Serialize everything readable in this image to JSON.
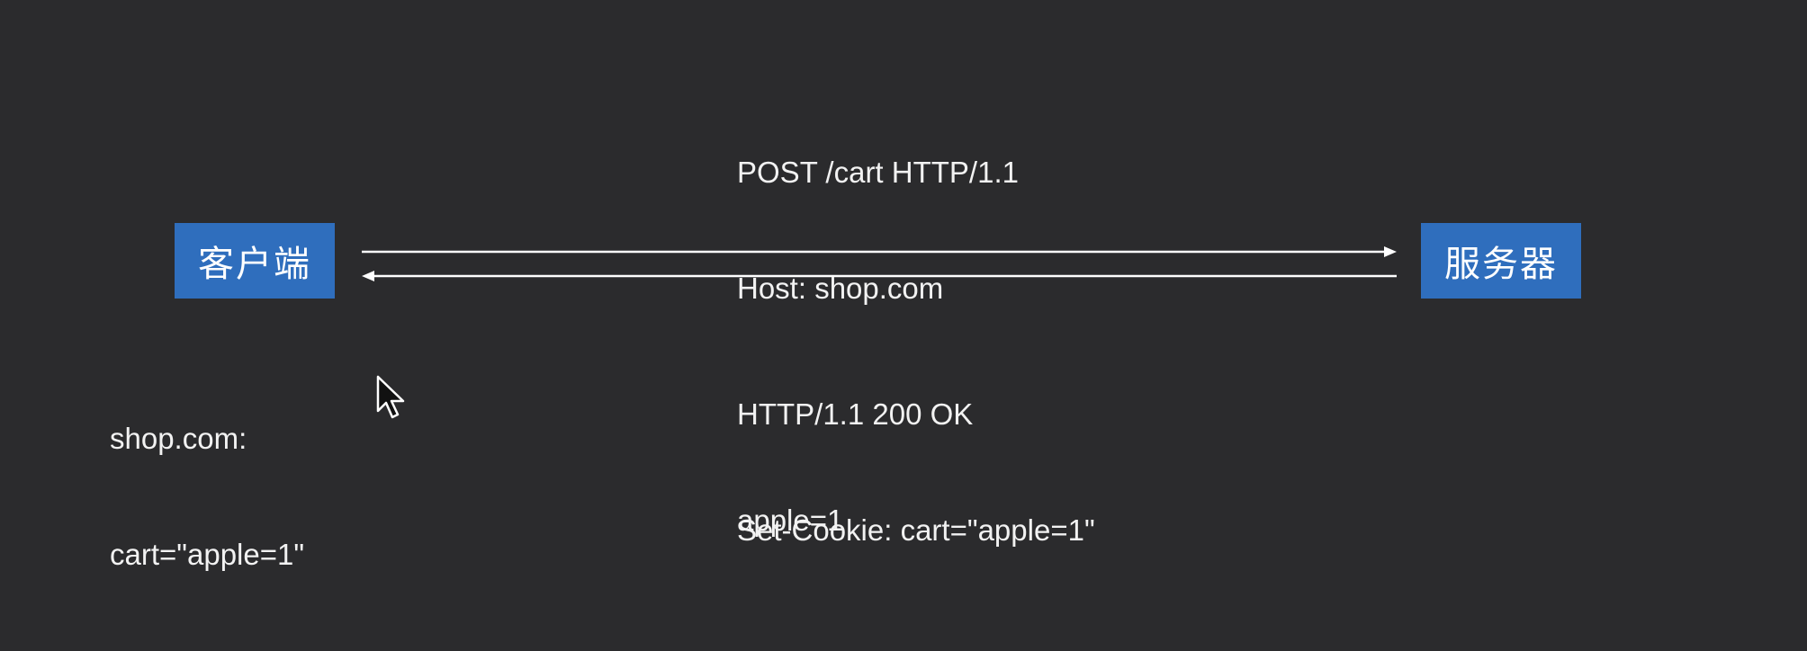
{
  "nodes": {
    "client": {
      "label": "客户端"
    },
    "server": {
      "label": "服务器"
    }
  },
  "request": {
    "lines": [
      "POST /cart HTTP/1.1",
      "Host: shop.com",
      "apple=1"
    ]
  },
  "response": {
    "lines": [
      "HTTP/1.1 200 OK",
      "Set-Cookie: cart=\"apple=1\""
    ]
  },
  "cookie_store": {
    "lines": [
      "shop.com:",
      "cart=\"apple=1\""
    ]
  },
  "colors": {
    "background": "#2b2b2d",
    "node_fill": "#2f6ebd",
    "text": "#f2f2f2",
    "arrow": "#ffffff"
  },
  "icons": {
    "cursor": "mouse-pointer-icon"
  }
}
